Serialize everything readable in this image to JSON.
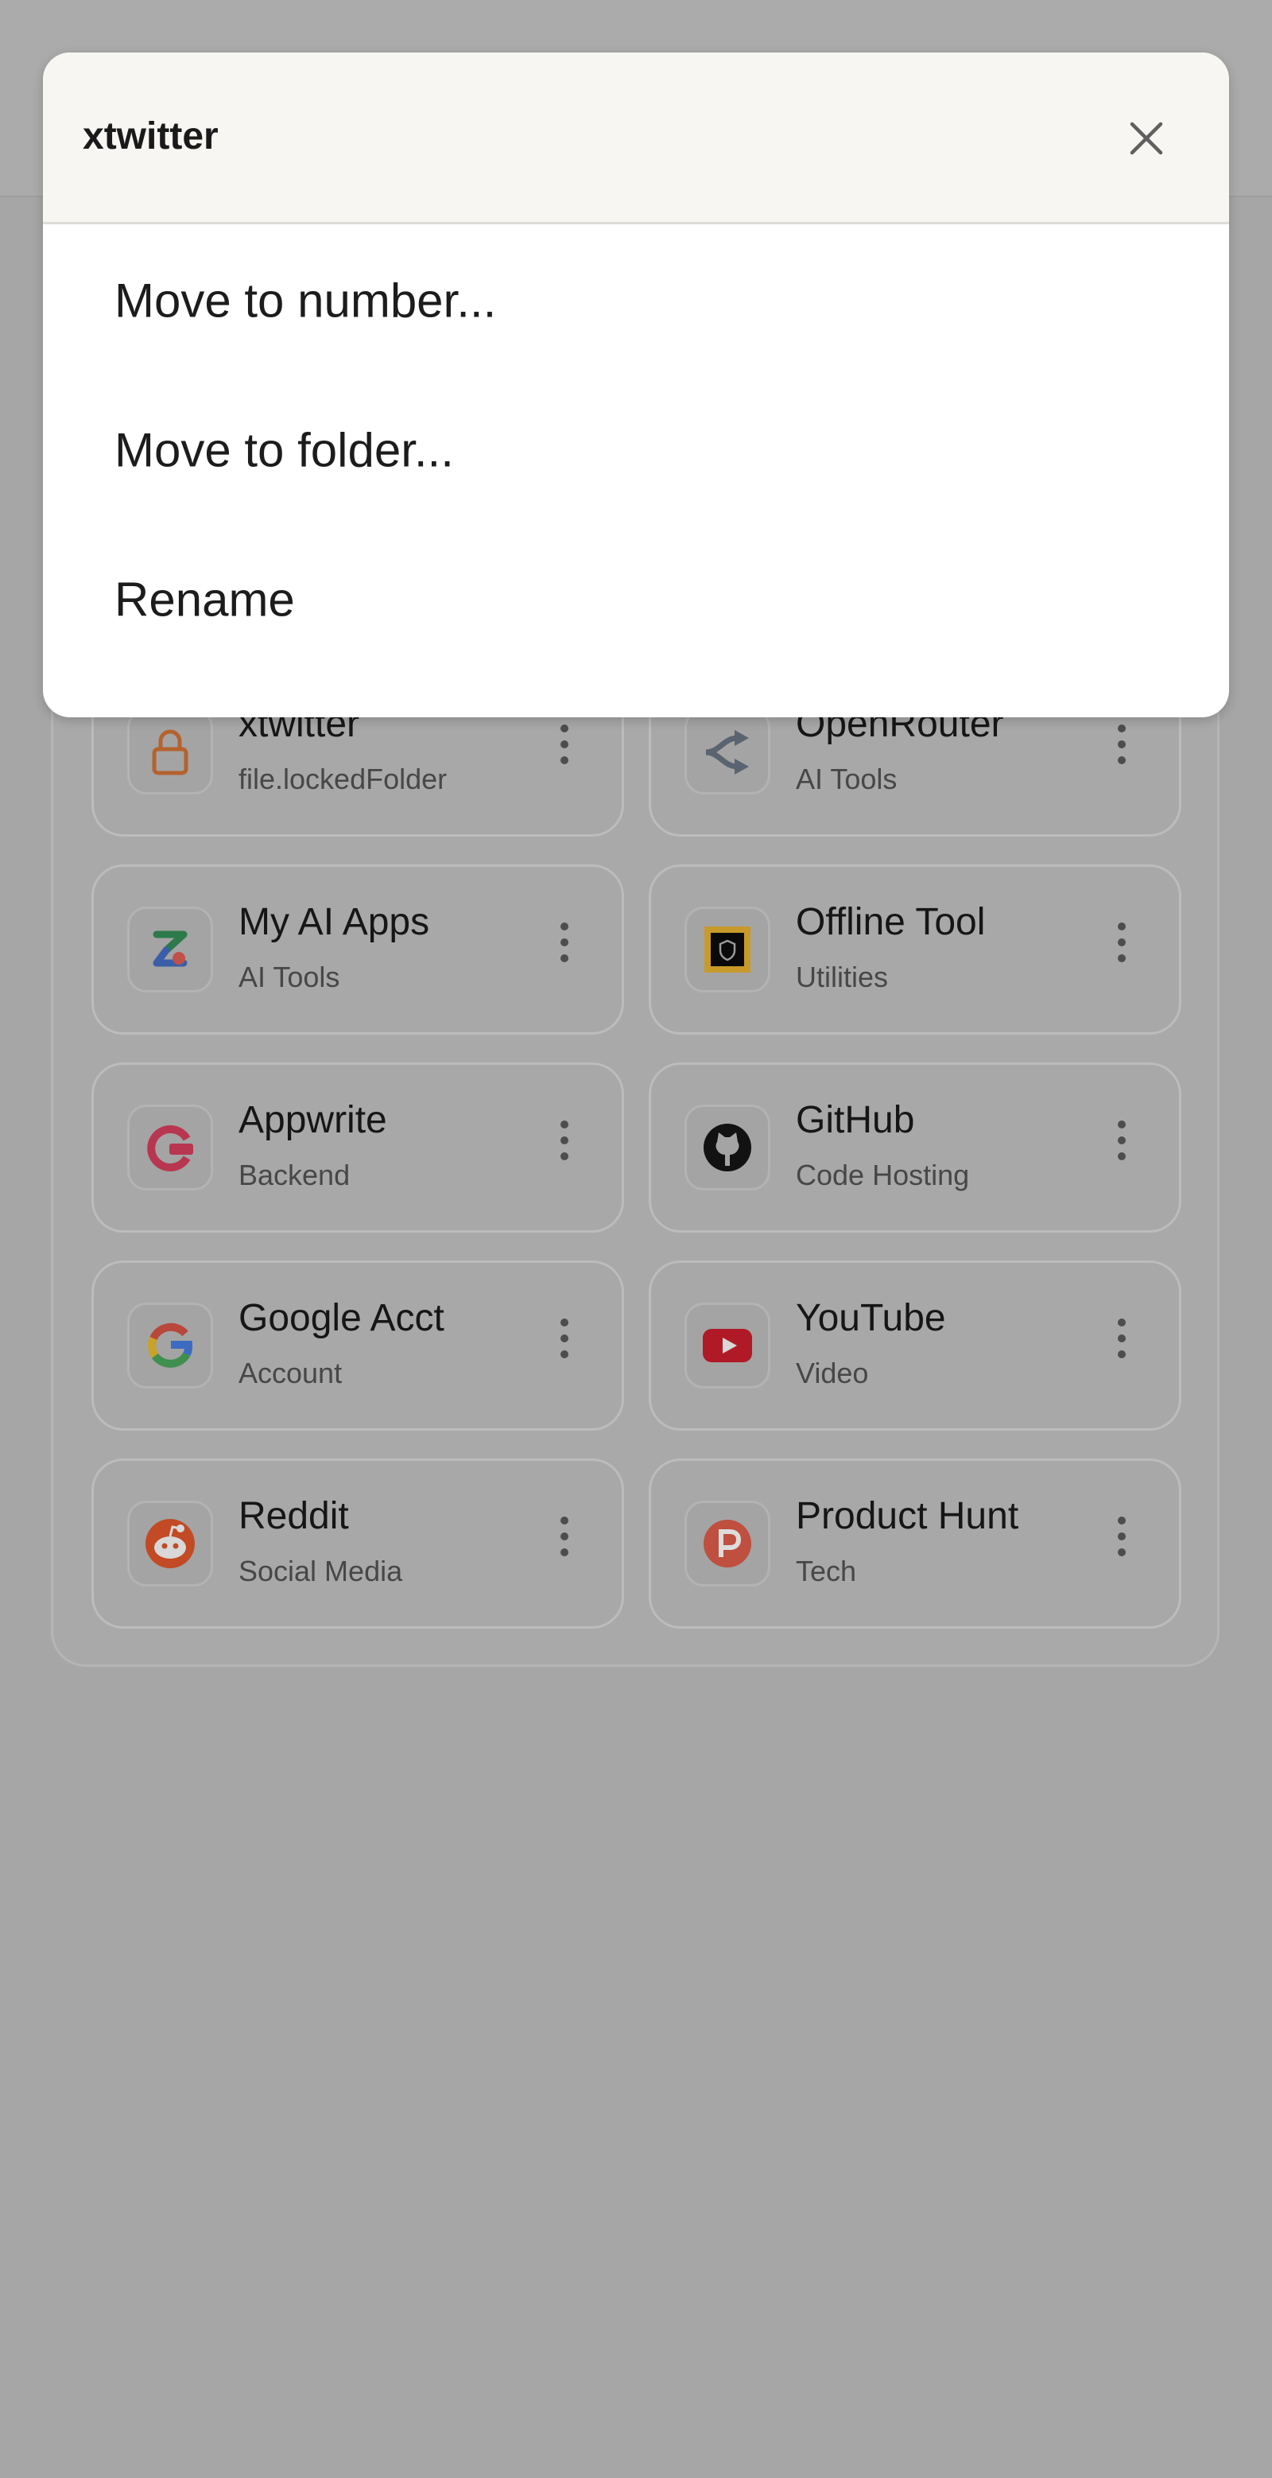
{
  "dialog": {
    "title": "xtwitter",
    "close_icon": "close-icon",
    "menu_items": [
      {
        "label": "Move to number..."
      },
      {
        "label": "Move to folder..."
      },
      {
        "label": "Rename"
      }
    ]
  },
  "background": {
    "cards": [
      {
        "title": "xtwitter",
        "subtitle": "file.lockedFolder",
        "icon": "lock-icon"
      },
      {
        "title": "OpenRouter",
        "subtitle": "AI Tools",
        "icon": "openrouter-icon"
      },
      {
        "title": "My AI Apps",
        "subtitle": "AI Tools",
        "icon": "my-ai-apps-icon"
      },
      {
        "title": "Offline Tool",
        "subtitle": "Utilities",
        "icon": "offline-tool-icon"
      },
      {
        "title": "Appwrite",
        "subtitle": "Backend",
        "icon": "appwrite-icon"
      },
      {
        "title": "GitHub",
        "subtitle": "Code Hosting",
        "icon": "github-icon"
      },
      {
        "title": "Google Acct",
        "subtitle": "Account",
        "icon": "google-icon"
      },
      {
        "title": "YouTube",
        "subtitle": "Video",
        "icon": "youtube-icon"
      },
      {
        "title": "Reddit",
        "subtitle": "Social Media",
        "icon": "reddit-icon"
      },
      {
        "title": "Product Hunt",
        "subtitle": "Tech",
        "icon": "product-hunt-icon"
      }
    ]
  },
  "colors": {
    "overlay": "#a6a6a6",
    "dialog_header_bg": "#f7f6f3",
    "dialog_bg": "#ffffff",
    "text_primary": "#1c1c1c"
  }
}
